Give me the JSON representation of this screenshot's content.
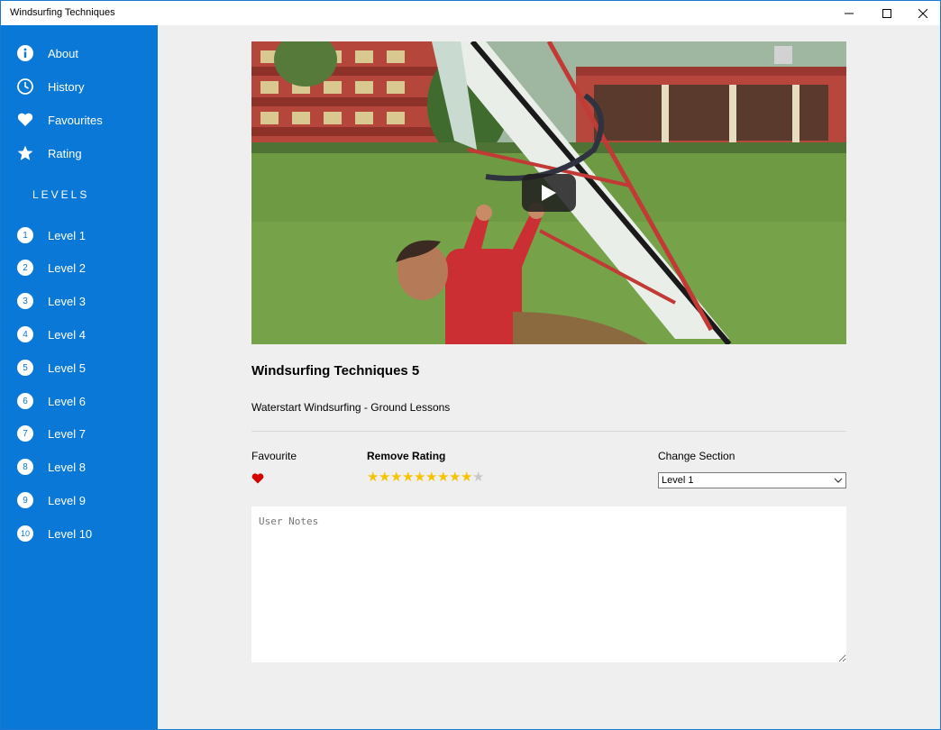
{
  "window": {
    "title": "Windsurfing Techniques"
  },
  "sidebar": {
    "menu": [
      {
        "label": "About",
        "icon": "info-icon"
      },
      {
        "label": "History",
        "icon": "clock-icon"
      },
      {
        "label": "Favourites",
        "icon": "heart-icon"
      },
      {
        "label": "Rating",
        "icon": "star-icon"
      }
    ],
    "levels_heading": "LEVELS",
    "levels": [
      {
        "num": "1",
        "label": "Level 1"
      },
      {
        "num": "2",
        "label": "Level 2"
      },
      {
        "num": "3",
        "label": "Level 3"
      },
      {
        "num": "4",
        "label": "Level 4"
      },
      {
        "num": "5",
        "label": "Level 5"
      },
      {
        "num": "6",
        "label": "Level 6"
      },
      {
        "num": "7",
        "label": "Level 7"
      },
      {
        "num": "8",
        "label": "Level 8"
      },
      {
        "num": "9",
        "label": "Level 9"
      },
      {
        "num": "10",
        "label": "Level 10"
      }
    ]
  },
  "main": {
    "video_title": "Windsurfing Techniques 5",
    "video_subtitle": "Waterstart Windsurfing - Ground Lessons",
    "favourite_label": "Favourite",
    "favourite_state": true,
    "rating_label": "Remove Rating",
    "rating": {
      "value": 9,
      "max": 10
    },
    "section_label": "Change Section",
    "section_selected": "Level 1",
    "notes_placeholder": "User Notes"
  },
  "colors": {
    "accent": "#0a78d7",
    "star_filled": "#f5c400",
    "star_empty": "#c8c8c8",
    "heart": "#d40000"
  }
}
